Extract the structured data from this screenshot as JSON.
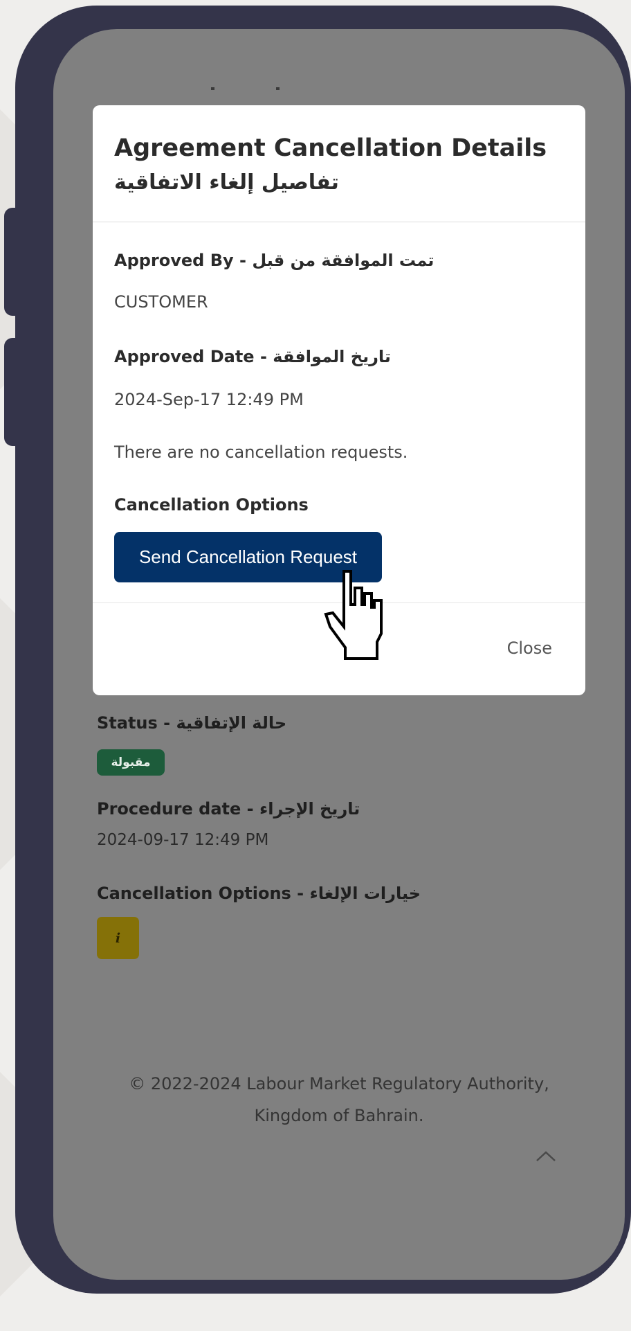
{
  "colors": {
    "frame": "#34344a",
    "overlay": "#808080",
    "primary_button": "#043268",
    "status_badge": "#1d5c3b",
    "info_button": "#857108"
  },
  "background": {
    "status_label": "Status - حالة الإتفاقية",
    "status_badge": "مقبولة",
    "procedure_label": "Procedure date - تاريخ الإجراء",
    "procedure_value": "2024-09-17 12:49 PM",
    "cancel_options_label": "Cancellation Options - خيارات الإلغاء",
    "info_icon": "i",
    "footer_line1": "© 2022-2024 Labour Market Regulatory Authority,",
    "footer_line2": "Kingdom of Bahrain.",
    "scroll_top_icon": "chevron-up-icon"
  },
  "modal": {
    "title": "Agreement Cancellation Details",
    "title_ar": "تفاصيل إلغاء الاتفاقية",
    "approved_by_label": "Approved By - تمت الموافقة من قبل",
    "approved_by_value": "CUSTOMER",
    "approved_date_label": "Approved Date - تاريخ الموافقة",
    "approved_date_value": "2024-Sep-17 12:49 PM",
    "no_requests_text": "There are no cancellation requests.",
    "options_label": "Cancellation Options",
    "send_button": "Send Cancellation Request",
    "close_button": "Close"
  }
}
